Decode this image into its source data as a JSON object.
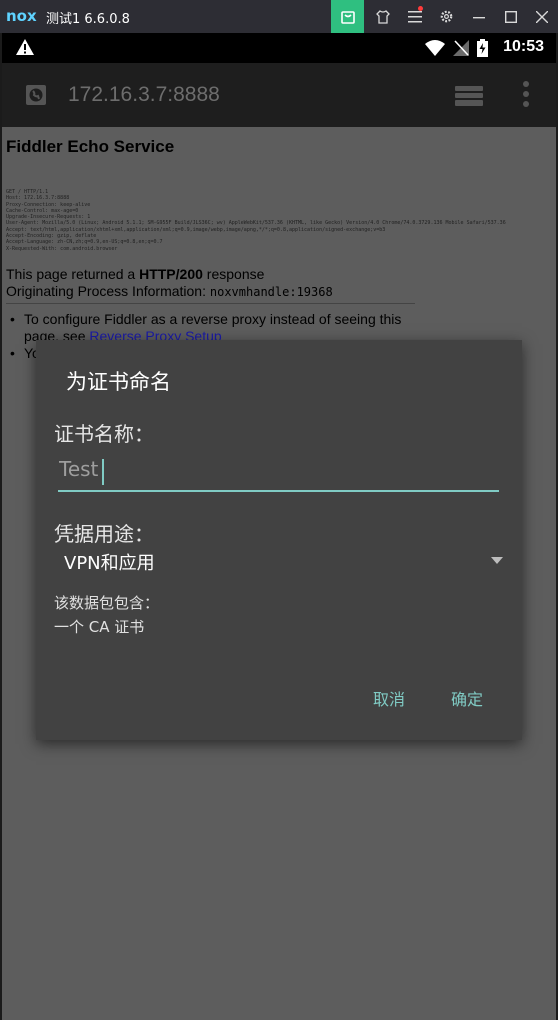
{
  "window": {
    "logo": "nox",
    "title": "测试1 6.6.0.8"
  },
  "statusbar": {
    "time": "10:53"
  },
  "browser": {
    "url": "172.16.3.7:8888"
  },
  "page": {
    "heading": "Fiddler Echo Service",
    "raw_request": "GET / HTTP/1.1\nHost: 172.16.3.7:8888\nProxy-Connection: keep-alive\nCache-Control: max-age=0\nUpgrade-Insecure-Requests: 1\nUser-Agent: Mozilla/5.0 (Linux; Android 5.1.1; SM-G955F Build/JLS36C; wv) AppleWebKit/537.36 (KHTML, like Gecko) Version/4.0 Chrome/74.0.3729.136 Mobile Safari/537.36\nAccept: text/html,application/xhtml+xml,application/xml;q=0.9,image/webp,image/apng,*/*;q=0.8,application/signed-exchange;v=b3\nAccept-Encoding: gzip, deflate\nAccept-Language: zh-CN,zh;q=0.9,en-US;q=0.8,en;q=0.7\nX-Requested-With: com.android.browser",
    "response_prefix": "This page returned a ",
    "response_code": "HTTP/200",
    "response_suffix": " response",
    "origin_label": "Originating Process Information: ",
    "origin_value": "noxvmhandle:19368",
    "bullet1_text": "To configure Fiddler as a reverse proxy instead of seeing this page, see ",
    "bullet1_link": "Reverse Proxy Setup",
    "bullet2_text": "Yo"
  },
  "dialog": {
    "title": "为证书命名",
    "name_label": "证书名称：",
    "name_value": "Test",
    "usage_label": "凭据用途：",
    "usage_value": "VPN和应用",
    "contains_label": "该数据包包含：",
    "contains_value": "一个 CA 证书",
    "cancel_label": "取消",
    "ok_label": "确定"
  },
  "colors": {
    "accent": "#80cbc4",
    "dialog_bg": "#424242",
    "page_dim": "#5d5d5d",
    "nox_green": "#2fbf80"
  }
}
